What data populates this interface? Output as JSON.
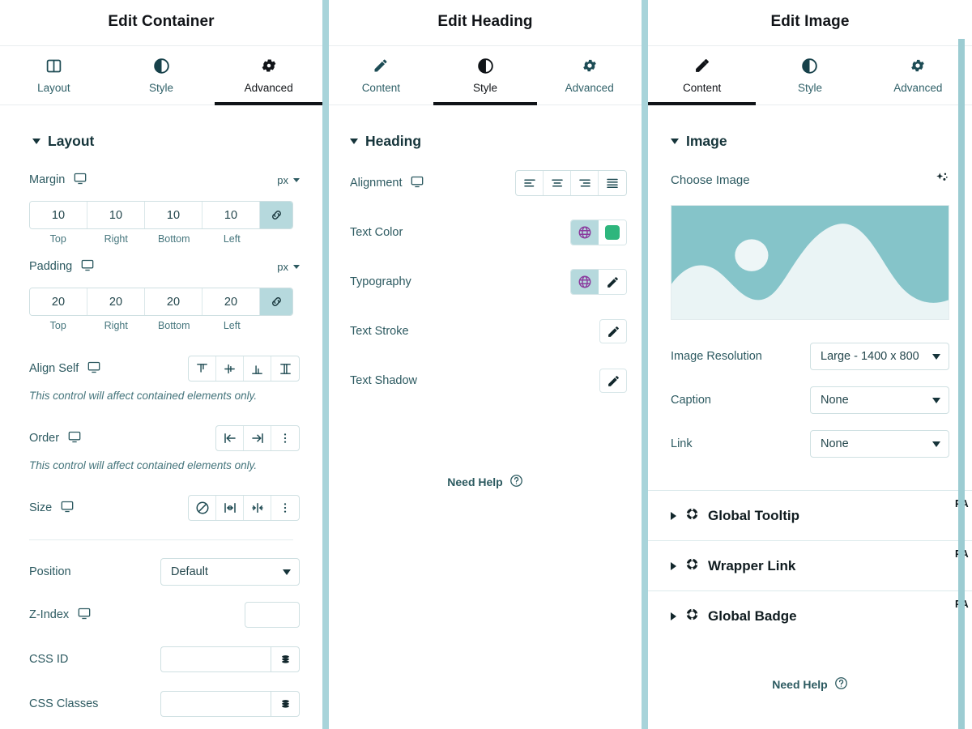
{
  "panels": {
    "container": {
      "title": "Edit Container",
      "tabs": [
        {
          "label": "Layout",
          "icon": "columns-icon",
          "active": false
        },
        {
          "label": "Style",
          "icon": "contrast-icon",
          "active": false
        },
        {
          "label": "Advanced",
          "icon": "gear-icon",
          "active": true
        }
      ],
      "section_title": "Layout",
      "margin": {
        "label": "Margin",
        "unit": "px",
        "values": [
          "10",
          "10",
          "10",
          "10"
        ],
        "side_labels": [
          "Top",
          "Right",
          "Bottom",
          "Left"
        ],
        "linked": true
      },
      "padding": {
        "label": "Padding",
        "unit": "px",
        "values": [
          "20",
          "20",
          "20",
          "20"
        ],
        "side_labels": [
          "Top",
          "Right",
          "Bottom",
          "Left"
        ],
        "linked": true
      },
      "align_self": {
        "label": "Align Self",
        "options": [
          "align-start-icon",
          "align-center-icon",
          "align-end-icon",
          "align-stretch-icon"
        ],
        "hint": "This control will affect contained elements only."
      },
      "order": {
        "label": "Order",
        "options": [
          "order-start-icon",
          "order-end-icon",
          "more-vertical-icon"
        ],
        "hint": "This control will affect contained elements only."
      },
      "size": {
        "label": "Size",
        "options": [
          "none-icon",
          "grow-icon",
          "shrink-icon",
          "more-vertical-icon"
        ]
      },
      "position": {
        "label": "Position",
        "value": "Default"
      },
      "z_index": {
        "label": "Z-Index",
        "value": ""
      },
      "css_id": {
        "label": "CSS ID",
        "value": ""
      },
      "css_classes": {
        "label": "CSS Classes",
        "value": ""
      }
    },
    "heading": {
      "title": "Edit Heading",
      "tabs": [
        {
          "label": "Content",
          "icon": "pencil-icon",
          "active": false
        },
        {
          "label": "Style",
          "icon": "contrast-icon",
          "active": true
        },
        {
          "label": "Advanced",
          "icon": "gear-icon",
          "active": false
        }
      ],
      "section_title": "Heading",
      "alignment": {
        "label": "Alignment",
        "options": [
          "align-left-icon",
          "align-center-icon",
          "align-right-icon",
          "align-justify-icon"
        ]
      },
      "text_color": {
        "label": "Text Color",
        "global": true,
        "swatch_color": "#2eb67d"
      },
      "typography": {
        "label": "Typography",
        "global": true,
        "edit": true
      },
      "text_stroke": {
        "label": "Text Stroke",
        "edit": true
      },
      "text_shadow": {
        "label": "Text Shadow",
        "edit": true
      },
      "need_help": "Need Help"
    },
    "image": {
      "title": "Edit Image",
      "tabs": [
        {
          "label": "Content",
          "icon": "pencil-icon",
          "active": true
        },
        {
          "label": "Style",
          "icon": "contrast-icon",
          "active": false
        },
        {
          "label": "Advanced",
          "icon": "gear-icon",
          "active": false
        }
      ],
      "section_title": "Image",
      "choose_image": {
        "label": "Choose Image",
        "ai_icon": "sparkle-icon"
      },
      "image_resolution": {
        "label": "Image Resolution",
        "value": "Large - 1400 x 800"
      },
      "caption": {
        "label": "Caption",
        "value": "None"
      },
      "link": {
        "label": "Link",
        "value": "None"
      },
      "accordions": [
        {
          "title": "Global Tooltip",
          "badge": "PA",
          "icon": "pafe-icon"
        },
        {
          "title": "Wrapper Link",
          "badge": "PA",
          "icon": "pafe-icon"
        },
        {
          "title": "Global Badge",
          "badge": "PA",
          "icon": "pafe-icon"
        }
      ],
      "need_help": "Need Help"
    }
  },
  "colors": {
    "accent_teal": "#b6d9dd",
    "scrollbar": "#a8d4da",
    "label_text": "#2d5a61",
    "active_tab": "#101418",
    "globe_purple": "#8b3b9e",
    "swatch_green": "#2eb67d",
    "image_sky": "#85c4c9",
    "image_hill": "#eaf4f5"
  }
}
